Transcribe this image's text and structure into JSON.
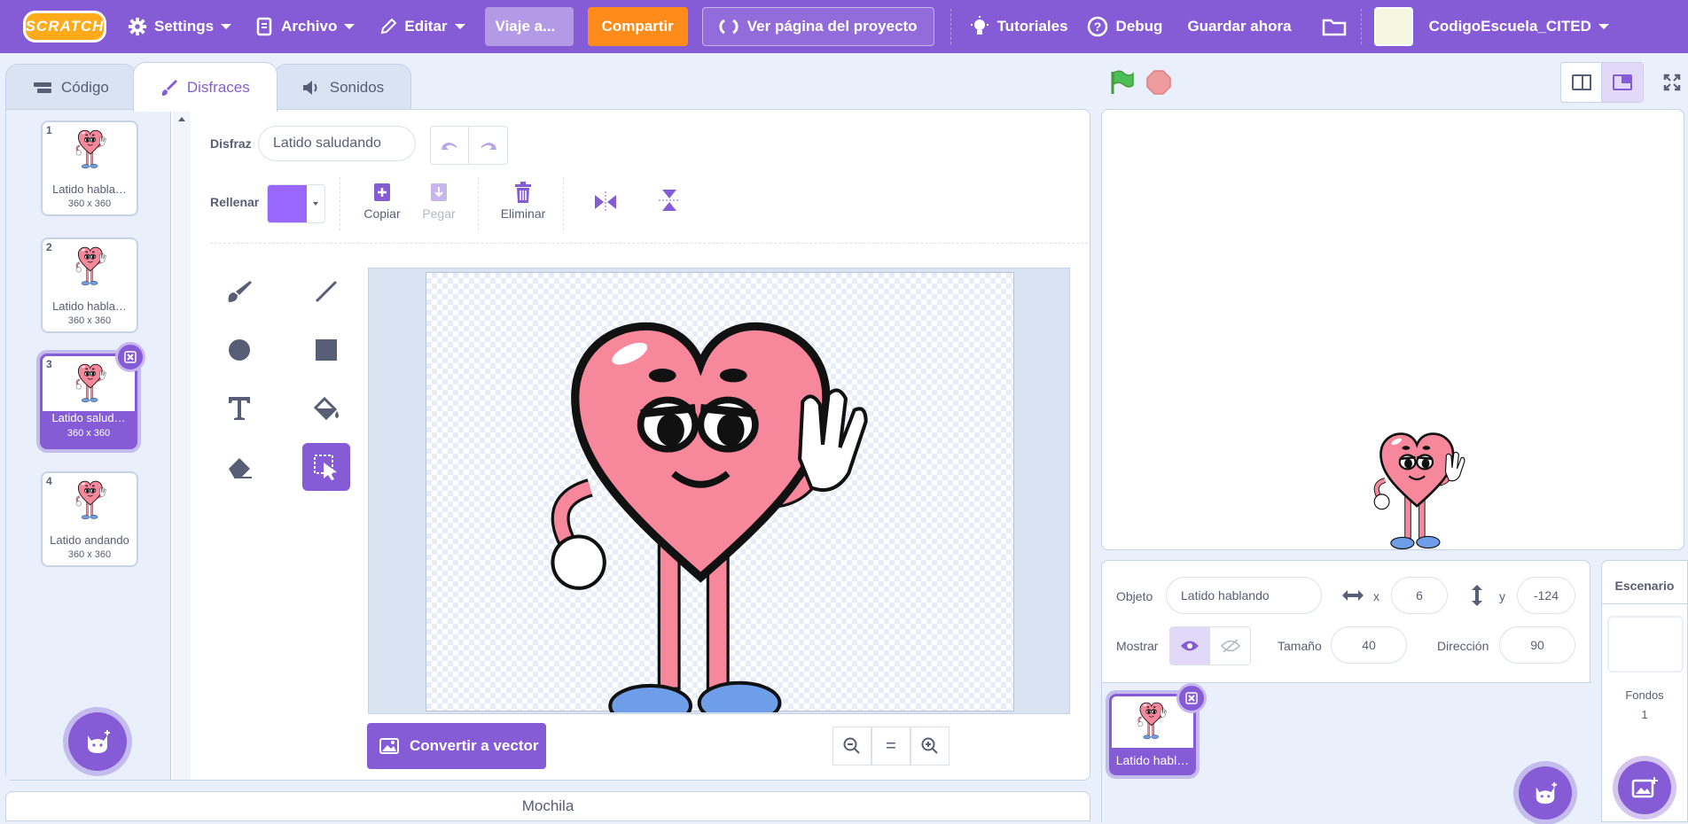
{
  "menu": {
    "logo": "SCRATCH",
    "settings": "Settings",
    "file": "Archivo",
    "edit": "Editar",
    "project_title": "Viaje a...",
    "share": "Compartir",
    "see_project": "Ver página del proyecto",
    "tutorials": "Tutoriales",
    "debug": "Debug",
    "save_now": "Guardar ahora",
    "username": "CodigoEscuela_CITED",
    "colors": {
      "bar": "#855cd6",
      "share": "#ff8c1a"
    }
  },
  "tabs": [
    {
      "label": "Código",
      "icon": "code-icon"
    },
    {
      "label": "Disfraces",
      "icon": "brush-icon",
      "active": true
    },
    {
      "label": "Sonidos",
      "icon": "speaker-icon"
    }
  ],
  "costumes": [
    {
      "num": "1",
      "name": "Latido habla…",
      "size": "360 x 360"
    },
    {
      "num": "2",
      "name": "Latido habla…",
      "size": "360 x 360"
    },
    {
      "num": "3",
      "name": "Latido salud…",
      "size": "360 x 360",
      "selected": true
    },
    {
      "num": "4",
      "name": "Latido andando",
      "size": "360 x 360"
    }
  ],
  "paint": {
    "costume_label": "Disfraz",
    "costume_name": "Latido saludando",
    "fill_label": "Rellenar",
    "fill_color": "#9966ff",
    "copy": "Copiar",
    "paste": "Pegar",
    "delete": "Eliminar",
    "convert": "Convertir a vector",
    "zoom_reset": "="
  },
  "backpack": "Mochila",
  "sprite": {
    "object_label": "Objeto",
    "object_name": "Latido hablando",
    "x_label": "x",
    "x": "6",
    "y_label": "y",
    "y": "-124",
    "show_label": "Mostrar",
    "size_label": "Tamaño",
    "size": "40",
    "direction_label": "Dirección",
    "direction": "90",
    "tile_name": "Latido habl…"
  },
  "stage_panel": {
    "title": "Escenario",
    "backdrops_label": "Fondos",
    "backdrops_count": "1"
  }
}
